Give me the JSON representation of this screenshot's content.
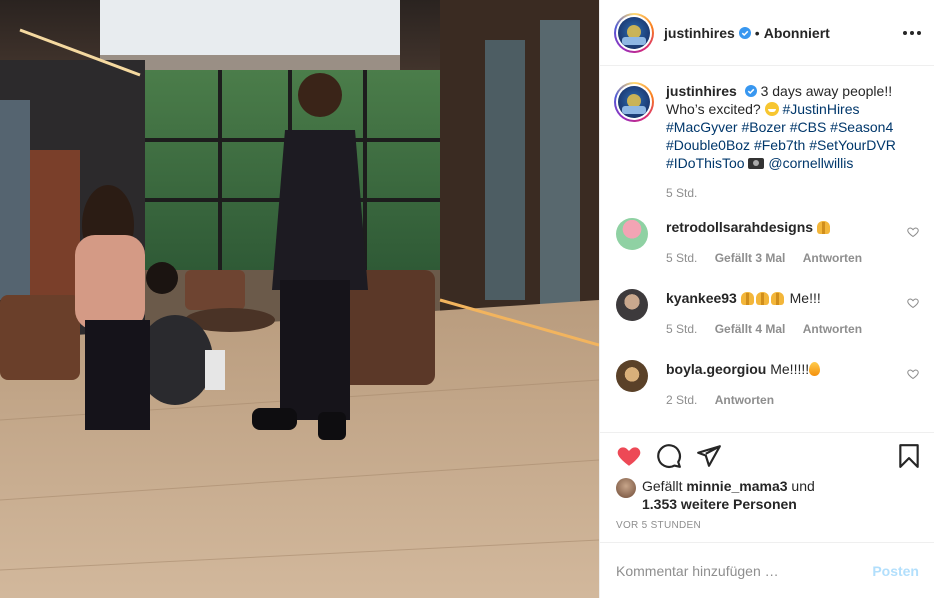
{
  "post": {
    "author": {
      "username": "justinhires",
      "verified": true,
      "avatar_icon": "avatar-icon"
    },
    "follow_state": "Abonniert",
    "separator": "•",
    "more_icon": "more-options-icon",
    "photo_icon": "post-photo"
  },
  "caption": {
    "username": "justinhires",
    "text": "3 days away people!! Who’s excited?",
    "hashtags_1": "#JustinHires",
    "hashtags_2": "#MacGyver #Bozer #CBS #Season4",
    "hashtags_3": "#Double0Boz #Feb7th #SetYourDVR",
    "hashtags_4": "#IDoThisToo",
    "mention": "@cornellwillis",
    "time": "5 Std."
  },
  "comments": [
    {
      "username": "retrodollsarahdesigns",
      "text": "",
      "time": "5 Std.",
      "likes": "",
      "reply": "Antworten"
    },
    {
      "username": "kyankee93",
      "text": "Me!!!",
      "time": "5 Std.",
      "likes": "Gefällt 4 Mal",
      "reply": "Antworten"
    },
    {
      "username": "boyla.georgiou",
      "text": "Me!!!!!",
      "time": "2 Std.",
      "likes": "",
      "reply": "Antworten"
    }
  ],
  "comments_extra": {
    "first_likes": "Gefällt 3 Mal"
  },
  "actions": {
    "like_icon": "heart-filled-icon",
    "comment_icon": "comment-icon",
    "share_icon": "share-icon",
    "save_icon": "bookmark-icon",
    "liked_by_prefix": "Gefällt",
    "liked_by_user": "minnie_mama3",
    "liked_by_and": "und",
    "liked_by_rest": "1.353 weitere Personen",
    "post_age": "VOR 5 STUNDEN"
  },
  "add_comment": {
    "placeholder": "Kommentar hinzufügen …",
    "post_label": "Posten"
  },
  "colors": {
    "heart": "#ed4956",
    "link": "#00376b",
    "muted": "#8e8e8e",
    "post_disabled": "#b2dffc"
  }
}
